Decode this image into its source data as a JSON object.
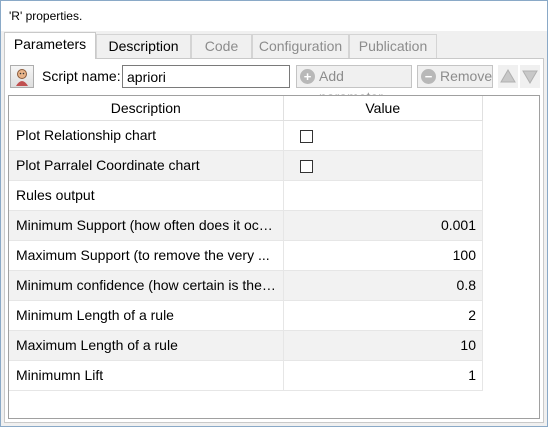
{
  "window": {
    "title": "'R' properties."
  },
  "tabs": [
    {
      "label": "Parameters",
      "state": "active"
    },
    {
      "label": "Description",
      "state": "normal"
    },
    {
      "label": "Code",
      "state": "disabled"
    },
    {
      "label": "Configuration",
      "state": "disabled"
    },
    {
      "label": "Publication",
      "state": "disabled"
    }
  ],
  "toolbar": {
    "script_icon": "r-script-icon",
    "script_label": "Script name:",
    "script_value": "apriori",
    "add_label": "Add parameter",
    "remove_label": "Remove",
    "move_up_icon": "triangle-up-icon",
    "move_down_icon": "triangle-down-icon"
  },
  "table": {
    "columns": [
      "Description",
      "Value"
    ],
    "rows": [
      {
        "description": "Plot Relationship chart",
        "value": "",
        "type": "checkbox",
        "checked": false
      },
      {
        "description": "Plot Parralel Coordinate chart",
        "value": "",
        "type": "checkbox",
        "checked": false
      },
      {
        "description": "Rules output",
        "value": "",
        "type": "text"
      },
      {
        "description": "Minimum Support (how often does it occ...",
        "value": "0.001",
        "type": "number"
      },
      {
        "description": "Maximum Support (to remove the very ...",
        "value": "100",
        "type": "number"
      },
      {
        "description": "Minimum confidence (how certain is the r...",
        "value": "0.8",
        "type": "number"
      },
      {
        "description": "Minimum Length of a rule",
        "value": "2",
        "type": "number"
      },
      {
        "description": "Maximum Length of a rule",
        "value": "10",
        "type": "number"
      },
      {
        "description": "Minimumn Lift",
        "value": "1",
        "type": "number"
      }
    ]
  },
  "colors": {
    "accent_border": "#8aa9c7",
    "disabled_text": "#8c8c8c",
    "stripe": "#f2f2f2"
  }
}
